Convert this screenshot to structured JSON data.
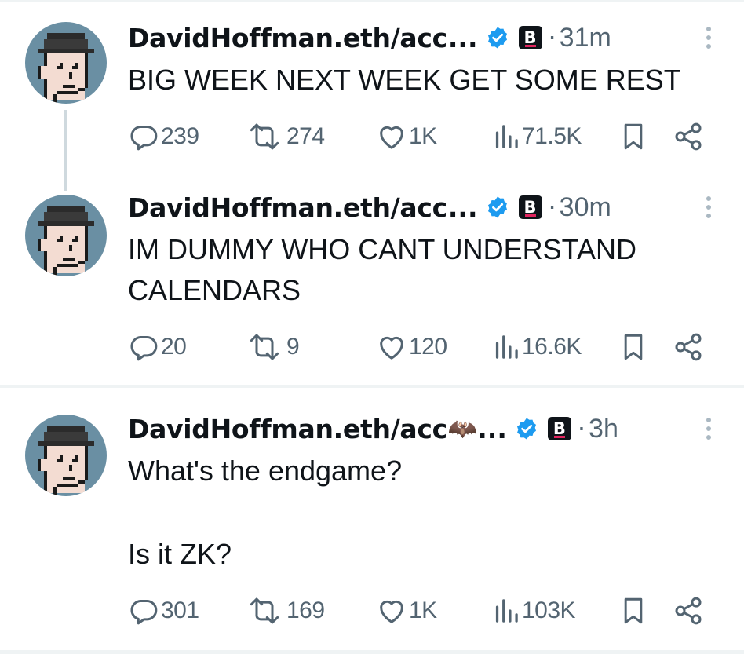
{
  "colors": {
    "text_primary": "#0f1419",
    "text_secondary": "#536471",
    "verified_blue": "#1d9bf0",
    "avatar_bg": "#6a8fa3",
    "divider": "#eff3f4"
  },
  "tweets": [
    {
      "author": "DavidHoffman.eth/acc",
      "ellipsis": "...",
      "emoji": "",
      "badge": "B",
      "separator": "·",
      "time": "31m",
      "paragraphs": [
        "BIG WEEK NEXT WEEK GET SOME REST"
      ],
      "replies": "239",
      "reposts": "274",
      "likes": "1K",
      "views": "71.5K"
    },
    {
      "author": "DavidHoffman.eth/acc",
      "ellipsis": "...",
      "emoji": "",
      "badge": "B",
      "separator": "·",
      "time": "30m",
      "paragraphs": [
        "IM DUMMY WHO CANT UNDERSTAND CALENDARS"
      ],
      "replies": "20",
      "reposts": "9",
      "likes": "120",
      "views": "16.6K"
    },
    {
      "author": "DavidHoffman.eth/acc",
      "ellipsis": "...",
      "emoji": "🦇",
      "badge": "B",
      "separator": "·",
      "time": "3h",
      "paragraphs": [
        "What's the endgame?",
        "Is it ZK?"
      ],
      "replies": "301",
      "reposts": "169",
      "likes": "1K",
      "views": "103K"
    }
  ],
  "icons": {
    "reply": "reply-icon",
    "repost": "repost-icon",
    "like": "heart-icon",
    "views": "views-icon",
    "bookmark": "bookmark-icon",
    "share": "share-icon",
    "more": "more-options-icon",
    "verified": "verified-badge-icon"
  }
}
